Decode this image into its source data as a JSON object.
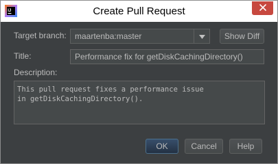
{
  "window": {
    "title": "Create Pull Request"
  },
  "icons": {
    "app": "intellij-idea-icon",
    "close": "close-icon",
    "dropdown": "chevron-down-icon"
  },
  "form": {
    "target_branch_label": "Target branch:",
    "target_branch_value": "maartenba:master",
    "show_diff_label": "Show Diff",
    "title_label": "Title:",
    "title_value": "Performance fix for getDiskCachingDirectory()",
    "description_label": "Description:",
    "description_lines": [
      "This pull request fixes a performance issue",
      "in getDiskCachingDirectory()."
    ]
  },
  "buttons": {
    "ok": "OK",
    "cancel": "Cancel",
    "help": "Help"
  },
  "colors": {
    "background": "#3c3f41",
    "close_button": "#c7483f",
    "default_button": "#384f6b",
    "text": "#bbbbbb"
  }
}
